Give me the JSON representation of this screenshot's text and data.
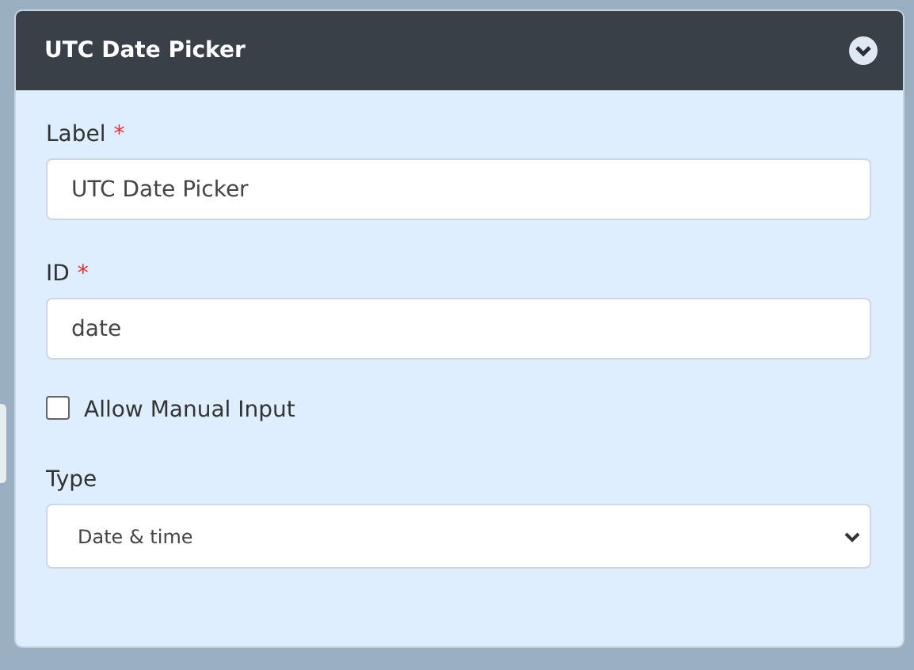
{
  "panel": {
    "title": "UTC Date Picker",
    "expanded": true
  },
  "fields": [
    {
      "kind": "text",
      "label": "Label",
      "required_mark": "*",
      "value": "UTC Date Picker"
    },
    {
      "kind": "text",
      "label": "ID",
      "required_mark": "*",
      "value": "date"
    },
    {
      "kind": "checkbox",
      "label": "Allow Manual Input",
      "checked": false
    },
    {
      "kind": "select",
      "label": "Type",
      "value": "Date & time"
    }
  ]
}
